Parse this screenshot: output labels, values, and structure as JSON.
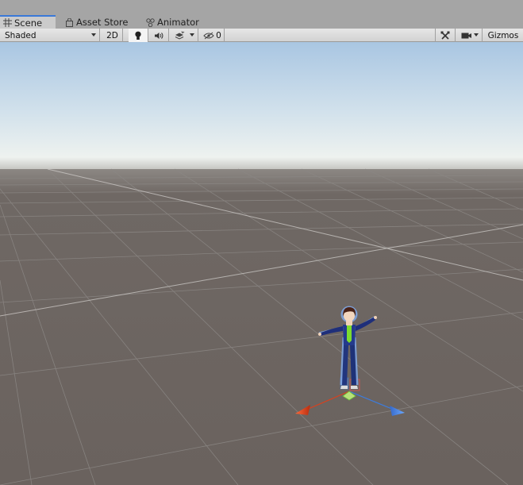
{
  "tabs": [
    {
      "label": "Scene",
      "icon": "grid-icon",
      "active": true
    },
    {
      "label": "Asset Store",
      "icon": "shopping-bag-icon",
      "active": false
    },
    {
      "label": "Animator",
      "icon": "animator-nodes-icon",
      "active": false
    }
  ],
  "toolbar": {
    "draw_mode": "Shaded",
    "mode_2d": "2D",
    "lighting_icon": "lightbulb-icon",
    "audio_icon": "speaker-icon",
    "effects_icon": "effects-stack-icon",
    "hidden_count": "0",
    "hidden_icon": "eye-slash-icon",
    "tools_icon": "crossed-tools-icon",
    "camera_icon": "camera-icon",
    "gizmos_label": "Gizmos"
  },
  "colors": {
    "sky_top": "#a9c6e2",
    "horizon": "#eef2ef",
    "ground": "#6b6460",
    "grid_line": "#8a8683",
    "x_axis": "#d9411e",
    "z_axis": "#3c7de0",
    "selection_outline": "#7fa7e6"
  }
}
